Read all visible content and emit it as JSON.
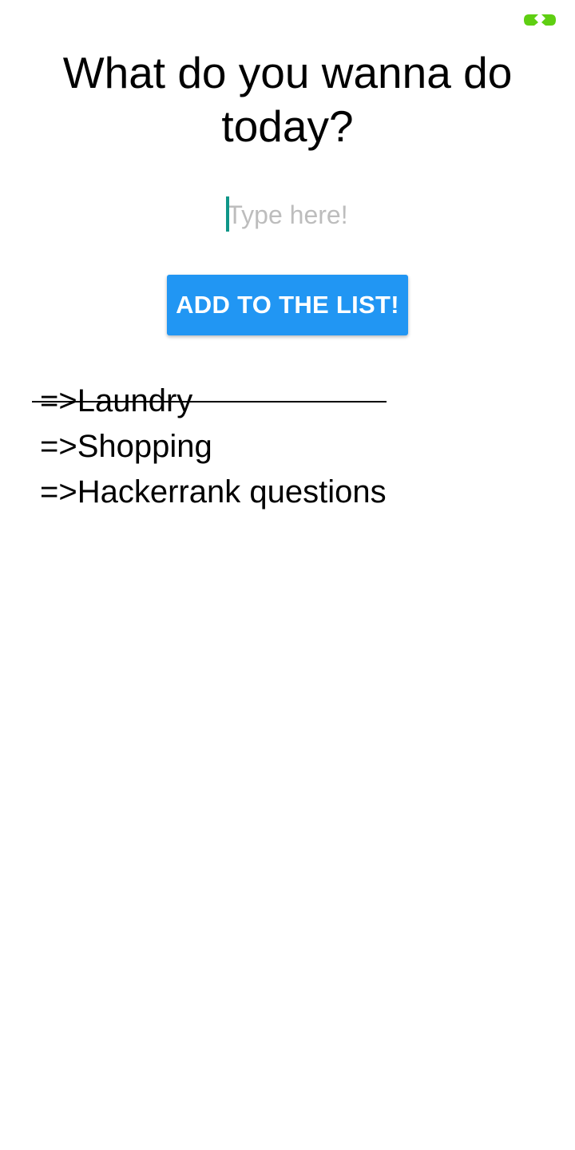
{
  "header": {
    "title": "What do you wanna do today?"
  },
  "input": {
    "placeholder": "Type here!",
    "value": ""
  },
  "add_button": {
    "label": "ADD TO THE LIST!"
  },
  "todos": [
    {
      "text": "=>Laundry",
      "done": true
    },
    {
      "text": "=>Shopping",
      "done": false
    },
    {
      "text": "=>Hackerrank questions",
      "done": false
    }
  ],
  "colors": {
    "accent_button": "#2196f3",
    "caret": "#0f9688",
    "placeholder": "#bdbdbd",
    "badge": "#5fcf12"
  },
  "icons": {
    "corner_badge": "double-chevron-badge-icon"
  }
}
